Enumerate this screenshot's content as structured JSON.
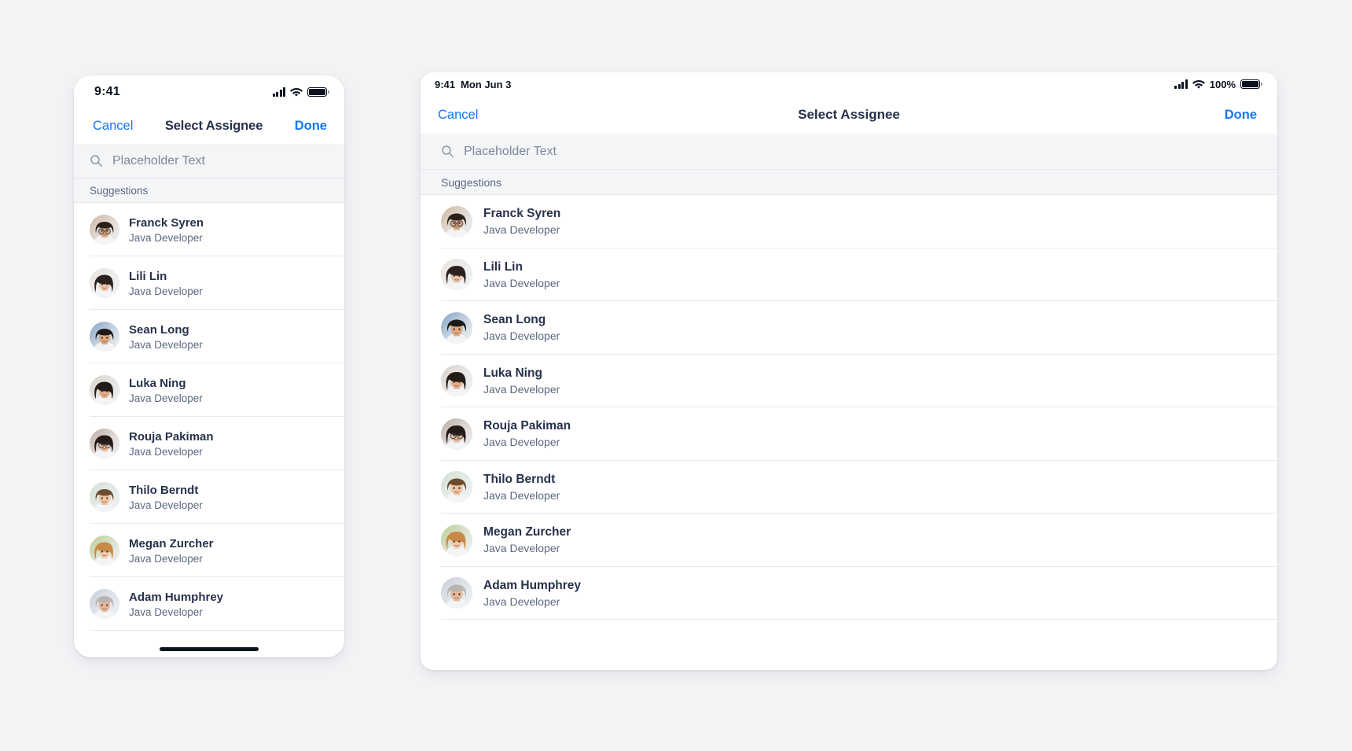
{
  "background_color": "#f2f3f5",
  "accent_color": "#1376f5",
  "text_primary_color": "#26314b",
  "text_secondary_color": "#5c6880",
  "phone": {
    "status": {
      "time": "9:41",
      "signal_icon": "cellular-signal-icon",
      "wifi_icon": "wifi-icon",
      "battery_icon": "battery-icon"
    },
    "nav": {
      "cancel_label": "Cancel",
      "title": "Select Assignee",
      "done_label": "Done"
    },
    "search": {
      "icon": "search-icon",
      "placeholder": "Placeholder Text",
      "value": ""
    },
    "section_header": "Suggestions",
    "home_indicator": "home-indicator"
  },
  "tablet": {
    "status": {
      "time": "9:41",
      "date": "Mon Jun 3",
      "battery_percent": "100%",
      "signal_icon": "cellular-signal-icon",
      "wifi_icon": "wifi-icon",
      "battery_icon": "battery-icon"
    },
    "nav": {
      "cancel_label": "Cancel",
      "title": "Select Assignee",
      "done_label": "Done"
    },
    "search": {
      "icon": "search-icon",
      "placeholder": "Placeholder Text",
      "value": ""
    },
    "section_header": "Suggestions"
  },
  "people": [
    {
      "name": "Franck Syren",
      "role": "Java Developer",
      "avatar": "avatar-franck-syren",
      "skin": "#d9a986",
      "hair": "#2a2019",
      "bg": "#c9b39a",
      "glasses": true,
      "gender": "m"
    },
    {
      "name": "Lili Lin",
      "role": "Java Developer",
      "avatar": "avatar-lili-lin",
      "skin": "#e9c3a6",
      "hair": "#2b2220",
      "bg": "#e8e2dc",
      "glasses": false,
      "gender": "f"
    },
    {
      "name": "Sean Long",
      "role": "Java Developer",
      "avatar": "avatar-sean-long",
      "skin": "#dca982",
      "hair": "#1e1a18",
      "bg": "#7f9fc0",
      "glasses": false,
      "gender": "m"
    },
    {
      "name": "Luka Ning",
      "role": "Java Developer",
      "avatar": "avatar-luka-ning",
      "skin": "#e3b08a",
      "hair": "#231b18",
      "bg": "#d8cfc6",
      "glasses": false,
      "gender": "f"
    },
    {
      "name": "Rouja Pakiman",
      "role": "Java Developer",
      "avatar": "avatar-rouja-pakiman",
      "skin": "#e6bb9c",
      "hair": "#241a18",
      "bg": "#b9a79b",
      "glasses": true,
      "gender": "f"
    },
    {
      "name": "Thilo Berndt",
      "role": "Java Developer",
      "avatar": "avatar-thilo-berndt",
      "skin": "#edc3a3",
      "hair": "#6d4b2f",
      "bg": "#cfded0",
      "glasses": false,
      "gender": "m"
    },
    {
      "name": "Megan Zurcher",
      "role": "Java Developer",
      "avatar": "avatar-megan-zurcher",
      "skin": "#f0cbad",
      "hair": "#c98a47",
      "bg": "#b7c98e",
      "glasses": false,
      "gender": "f"
    },
    {
      "name": "Adam Humphrey",
      "role": "Java Developer",
      "avatar": "avatar-adam-humphrey",
      "skin": "#e3b89a",
      "hair": "#b9b4ae",
      "bg": "#c3ccd6",
      "glasses": false,
      "gender": "m"
    }
  ]
}
